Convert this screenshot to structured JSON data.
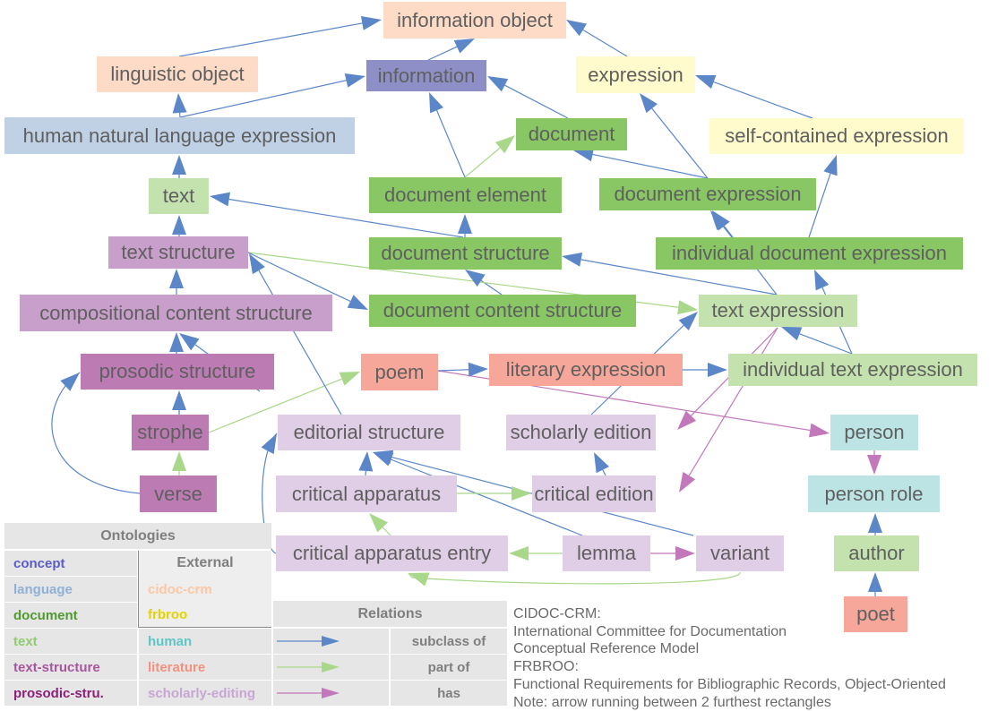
{
  "colors": {
    "concept": "#8e8fc6",
    "language": "#c0d1e6",
    "document": "#89c765",
    "text": "#c3e2ad",
    "text_structure": "#c89fcb",
    "prosodic": "#bd7bb4",
    "cidoc": "#fddbc6",
    "frbroo": "#fffbcc",
    "human": "#bde4e4",
    "literature": "#f7a79a",
    "scholarly": "#e0cde6",
    "subclass": "#5b87c8",
    "partof": "#a9d88a",
    "has": "#c278ba"
  },
  "nodes": [
    {
      "id": "information-object",
      "label": "information object",
      "cls": "cidoc"
    },
    {
      "id": "linguistic-object",
      "label": "linguistic object",
      "cls": "cidoc"
    },
    {
      "id": "information",
      "label": "information",
      "cls": "concept"
    },
    {
      "id": "expression",
      "label": "expression",
      "cls": "frbroo"
    },
    {
      "id": "human-natural-language-expression",
      "label": "human natural language expression",
      "cls": "language"
    },
    {
      "id": "document",
      "label": "document",
      "cls": "document"
    },
    {
      "id": "self-contained-expression",
      "label": "self-contained expression",
      "cls": "frbroo"
    },
    {
      "id": "text",
      "label": "text",
      "cls": "text"
    },
    {
      "id": "document-element",
      "label": "document element",
      "cls": "document"
    },
    {
      "id": "document-expression",
      "label": "document expression",
      "cls": "document"
    },
    {
      "id": "text-structure",
      "label": "text structure",
      "cls": "text_structure"
    },
    {
      "id": "document-structure",
      "label": "document structure",
      "cls": "document"
    },
    {
      "id": "individual-document-expression",
      "label": "individual document expression",
      "cls": "document"
    },
    {
      "id": "compositional-content-structure",
      "label": "compositional content structure",
      "cls": "text_structure"
    },
    {
      "id": "document-content-structure",
      "label": "document content structure",
      "cls": "document"
    },
    {
      "id": "text-expression",
      "label": "text expression",
      "cls": "text"
    },
    {
      "id": "prosodic-structure",
      "label": "prosodic structure",
      "cls": "prosodic"
    },
    {
      "id": "poem",
      "label": "poem",
      "cls": "literature"
    },
    {
      "id": "literary-expression",
      "label": "literary expression",
      "cls": "literature"
    },
    {
      "id": "individual-text-expression",
      "label": "individual text expression",
      "cls": "text"
    },
    {
      "id": "strophe",
      "label": "strophe",
      "cls": "prosodic"
    },
    {
      "id": "editorial-structure",
      "label": "editorial structure",
      "cls": "scholarly"
    },
    {
      "id": "scholarly-edition",
      "label": "scholarly edition",
      "cls": "scholarly"
    },
    {
      "id": "person",
      "label": "person",
      "cls": "human"
    },
    {
      "id": "verse",
      "label": "verse",
      "cls": "prosodic"
    },
    {
      "id": "critical-apparatus",
      "label": "critical apparatus",
      "cls": "scholarly"
    },
    {
      "id": "critical-edition",
      "label": "critical edition",
      "cls": "scholarly"
    },
    {
      "id": "person-role",
      "label": "person role",
      "cls": "human"
    },
    {
      "id": "critical-apparatus-entry",
      "label": "critical apparatus entry",
      "cls": "scholarly"
    },
    {
      "id": "lemma",
      "label": "lemma",
      "cls": "scholarly"
    },
    {
      "id": "variant",
      "label": "variant",
      "cls": "scholarly"
    },
    {
      "id": "author",
      "label": "author",
      "cls": "text"
    },
    {
      "id": "poet",
      "label": "poet",
      "cls": "literature"
    }
  ],
  "edges": [
    {
      "from": "linguistic-object",
      "to": "information-object",
      "type": "subclass"
    },
    {
      "from": "information",
      "to": "information-object",
      "type": "subclass"
    },
    {
      "from": "expression",
      "to": "information-object",
      "type": "subclass"
    },
    {
      "from": "human-natural-language-expression",
      "to": "linguistic-object",
      "type": "subclass"
    },
    {
      "from": "human-natural-language-expression",
      "to": "information",
      "type": "subclass"
    },
    {
      "from": "document",
      "to": "information",
      "type": "subclass"
    },
    {
      "from": "document-element",
      "to": "information",
      "type": "subclass"
    },
    {
      "from": "document-element",
      "to": "document",
      "type": "partof"
    },
    {
      "from": "self-contained-expression",
      "to": "expression",
      "type": "subclass"
    },
    {
      "from": "document-expression",
      "to": "expression",
      "type": "subclass"
    },
    {
      "from": "document-expression",
      "to": "document",
      "type": "subclass"
    },
    {
      "from": "text",
      "to": "human-natural-language-expression",
      "type": "subclass"
    },
    {
      "from": "document-structure",
      "to": "text",
      "type": "subclass"
    },
    {
      "from": "document-structure",
      "to": "document-element",
      "type": "subclass"
    },
    {
      "from": "individual-document-expression",
      "to": "document-expression",
      "type": "subclass"
    },
    {
      "from": "individual-document-expression",
      "to": "self-contained-expression",
      "type": "subclass"
    },
    {
      "from": "text-structure",
      "to": "text",
      "type": "subclass"
    },
    {
      "from": "text-structure",
      "to": "document-content-structure",
      "type": "subclass"
    },
    {
      "from": "text-structure",
      "to": "text-expression",
      "type": "partof"
    },
    {
      "from": "text-expression",
      "to": "document-structure",
      "type": "subclass"
    },
    {
      "from": "text-expression",
      "to": "document-expression",
      "type": "subclass"
    },
    {
      "from": "document-content-structure",
      "to": "document-structure",
      "type": "subclass"
    },
    {
      "from": "compositional-content-structure",
      "to": "text-structure",
      "type": "subclass"
    },
    {
      "from": "editorial-structure",
      "to": "text-structure",
      "type": "subclass"
    },
    {
      "from": "individual-text-expression",
      "to": "individual-document-expression",
      "type": "subclass"
    },
    {
      "from": "individual-text-expression",
      "to": "text-expression",
      "type": "subclass"
    },
    {
      "from": "prosodic-structure",
      "to": "compositional-content-structure",
      "type": "subclass"
    },
    {
      "from": "editorial-structure",
      "to": "compositional-content-structure",
      "type": "subclass"
    },
    {
      "from": "poem",
      "to": "literary-expression",
      "type": "subclass"
    },
    {
      "from": "poem",
      "to": "person",
      "type": "has"
    },
    {
      "from": "literary-expression",
      "to": "individual-text-expression",
      "type": "subclass"
    },
    {
      "from": "scholarly-edition",
      "to": "text-expression",
      "type": "subclass"
    },
    {
      "from": "text-expression",
      "to": "scholarly-edition",
      "type": "has"
    },
    {
      "from": "text-expression",
      "to": "critical-edition",
      "type": "has"
    },
    {
      "from": "strophe",
      "to": "prosodic-structure",
      "type": "subclass"
    },
    {
      "from": "strophe",
      "to": "poem",
      "type": "partof"
    },
    {
      "from": "verse",
      "to": "strophe",
      "type": "partof"
    },
    {
      "from": "verse",
      "to": "prosodic-structure",
      "type": "subclass"
    },
    {
      "from": "critical-apparatus",
      "to": "editorial-structure",
      "type": "subclass"
    },
    {
      "from": "critical-apparatus",
      "to": "critical-edition",
      "type": "partof"
    },
    {
      "from": "critical-edition",
      "to": "scholarly-edition",
      "type": "subclass"
    },
    {
      "from": "critical-apparatus-entry",
      "to": "critical-apparatus",
      "type": "partof"
    },
    {
      "from": "critical-apparatus-entry",
      "to": "editorial-structure",
      "type": "subclass"
    },
    {
      "from": "lemma",
      "to": "editorial-structure",
      "type": "subclass"
    },
    {
      "from": "lemma",
      "to": "critical-apparatus-entry",
      "type": "partof"
    },
    {
      "from": "lemma",
      "to": "variant",
      "type": "has"
    },
    {
      "from": "variant",
      "to": "editorial-structure",
      "type": "subclass"
    },
    {
      "from": "variant",
      "to": "critical-apparatus-entry",
      "type": "partof"
    },
    {
      "from": "person",
      "to": "person-role",
      "type": "has"
    },
    {
      "from": "author",
      "to": "person-role",
      "type": "subclass"
    },
    {
      "from": "poet",
      "to": "author",
      "type": "subclass"
    }
  ],
  "legend": {
    "ontologies_title": "Ontologies",
    "external_title": "External",
    "ontologies": [
      {
        "label": "concept",
        "color": "#5b5bc8"
      },
      {
        "label": "language",
        "color": "#8fb0d8"
      },
      {
        "label": "document",
        "color": "#4f9a2f"
      },
      {
        "label": "text",
        "color": "#8fcc6e"
      },
      {
        "label": "text-structure",
        "color": "#a8559e"
      },
      {
        "label": "prosodic-stru.",
        "color": "#8c1f78"
      }
    ],
    "external": [
      {
        "label": "cidoc-crm",
        "color": "#fdc7a3"
      },
      {
        "label": "frbroo",
        "color": "#e6d200"
      }
    ],
    "more_ontologies": [
      {
        "label": "human",
        "color": "#5ec6c6"
      },
      {
        "label": "literature",
        "color": "#f39180"
      },
      {
        "label": "scholarly-editing",
        "color": "#c7a6d4"
      }
    ],
    "relations_title": "Relations",
    "relations": [
      {
        "label": "subclass of",
        "type": "subclass"
      },
      {
        "label": "part of",
        "type": "partof"
      },
      {
        "label": "has",
        "type": "has"
      }
    ]
  },
  "notes": [
    "CIDOC-CRM:",
    "International Committee for Documentation",
    "Conceptual Reference Model",
    "FRBROO:",
    "Functional Requirements for Bibliographic Records, Object-Oriented",
    "Note: arrow running between 2 furthest rectangles"
  ]
}
